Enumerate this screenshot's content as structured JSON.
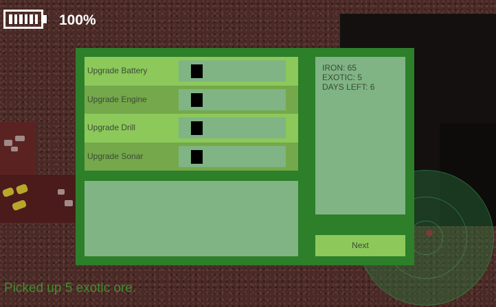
{
  "hud": {
    "battery_icon": "battery-icon",
    "battery_level": 1.0,
    "battery_text": "100%",
    "status_message": "Picked up 5 exotic ore."
  },
  "upgrades": [
    {
      "label": "Upgrade Battery",
      "level": 1
    },
    {
      "label": "Upgrade Engine",
      "level": 1
    },
    {
      "label": "Upgrade Drill",
      "level": 1
    },
    {
      "label": "Upgrade Sonar",
      "level": 1
    }
  ],
  "stats": {
    "iron": "IRON: 65",
    "exotic": "EXOTIC: 5",
    "days_left": "DAYS LEFT: 6"
  },
  "buttons": {
    "next_label": "Next"
  },
  "colors": {
    "panel_border": "#2d7f2a",
    "row_light": "#8cc85a",
    "row_dark": "#74a84a",
    "box_fill": "#80b484",
    "status_text": "#3f8f2e"
  }
}
